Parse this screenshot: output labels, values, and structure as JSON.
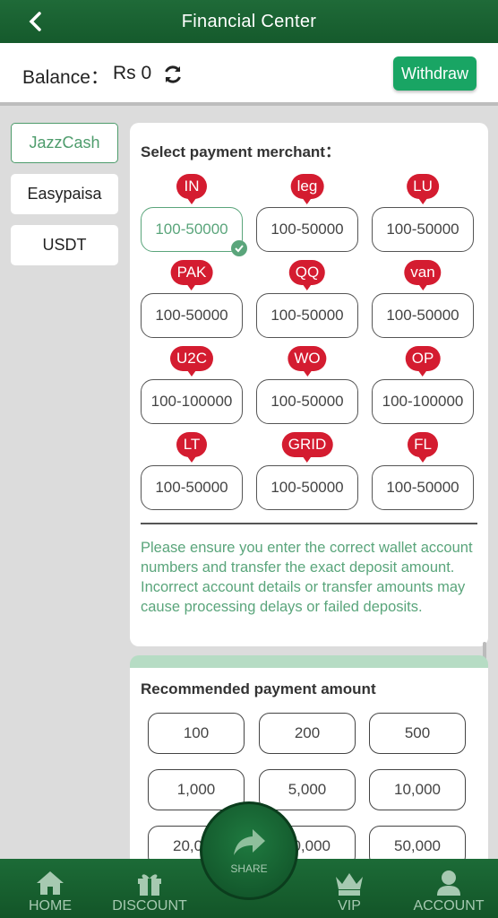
{
  "header": {
    "title": "Financial Center"
  },
  "balance": {
    "label": "Balance：",
    "value": "Rs 0",
    "withdraw_label": "Withdraw"
  },
  "methods": [
    {
      "label": "JazzCash",
      "active": true
    },
    {
      "label": "Easypaisa",
      "active": false
    },
    {
      "label": "USDT",
      "active": false
    }
  ],
  "merchant_section": {
    "title": "Select payment merchant：",
    "merchants": [
      {
        "tag": "IN",
        "range": "100-50000",
        "selected": true
      },
      {
        "tag": "leg",
        "range": "100-50000",
        "selected": false
      },
      {
        "tag": "LU",
        "range": "100-50000",
        "selected": false
      },
      {
        "tag": "PAK",
        "range": "100-50000",
        "selected": false
      },
      {
        "tag": "QQ",
        "range": "100-50000",
        "selected": false
      },
      {
        "tag": "van",
        "range": "100-50000",
        "selected": false
      },
      {
        "tag": "U2C",
        "range": "100-100000",
        "selected": false
      },
      {
        "tag": "WO",
        "range": "100-50000",
        "selected": false
      },
      {
        "tag": "OP",
        "range": "100-100000",
        "selected": false
      },
      {
        "tag": "LT",
        "range": "100-50000",
        "selected": false
      },
      {
        "tag": "GRID",
        "range": "100-50000",
        "selected": false
      },
      {
        "tag": "FL",
        "range": "100-50000",
        "selected": false
      }
    ],
    "note": "Please ensure you enter the correct wallet account numbers and transfer the exact deposit amount. Incorrect account details or transfer amounts may cause processing delays or failed deposits."
  },
  "amount_section": {
    "title": "Recommended payment amount",
    "amounts": [
      "100",
      "200",
      "500",
      "1,000",
      "5,000",
      "10,000",
      "20,000",
      "30,000",
      "50,000"
    ]
  },
  "nav": {
    "home": "HOME",
    "discount": "DISCOUNT",
    "share": "SHARE",
    "vip": "VIP",
    "account": "ACCOUNT"
  },
  "colors": {
    "header_green": "#1f6a38",
    "accent_green": "#5aa57b",
    "withdraw_green": "#19a564",
    "badge_red": "#d41c30"
  }
}
